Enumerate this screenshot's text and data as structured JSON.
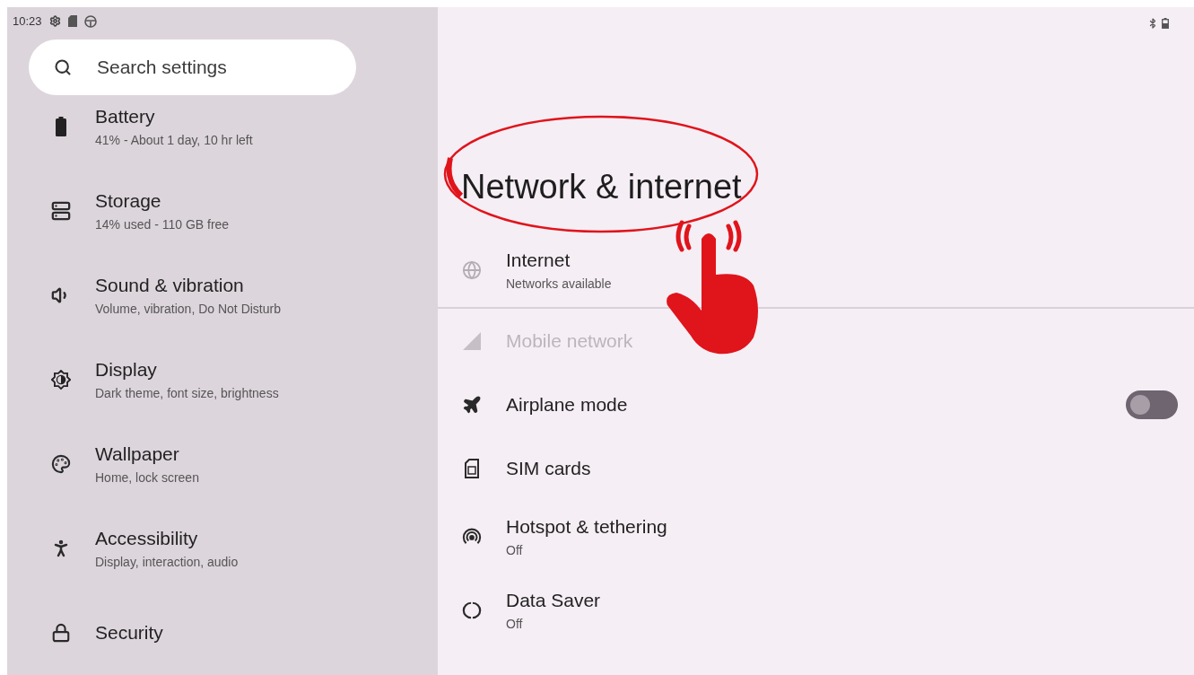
{
  "status_bar": {
    "time": "10:23"
  },
  "sidebar": {
    "search": {
      "placeholder": "Search settings"
    },
    "items": [
      {
        "title": "Battery",
        "subtitle": "41% - About 1 day, 10 hr left"
      },
      {
        "title": "Storage",
        "subtitle": "14% used - 110 GB free"
      },
      {
        "title": "Sound & vibration",
        "subtitle": "Volume, vibration, Do Not Disturb"
      },
      {
        "title": "Display",
        "subtitle": "Dark theme, font size, brightness"
      },
      {
        "title": "Wallpaper",
        "subtitle": "Home, lock screen"
      },
      {
        "title": "Accessibility",
        "subtitle": "Display, interaction, audio"
      },
      {
        "title": "Security"
      }
    ]
  },
  "content": {
    "title": "Network & internet",
    "rows": [
      {
        "kind": "link",
        "title": "Internet",
        "subtitle": "Networks available",
        "disabled": false
      },
      {
        "kind": "link",
        "title": "Mobile network",
        "disabled": true
      },
      {
        "kind": "toggle",
        "title": "Airplane mode",
        "disabled": false,
        "on": false
      },
      {
        "kind": "link",
        "title": "SIM cards",
        "disabled": false
      },
      {
        "kind": "link",
        "title": "Hotspot & tethering",
        "subtitle": "Off",
        "disabled": false
      },
      {
        "kind": "link",
        "title": "Data Saver",
        "subtitle": "Off",
        "disabled": false
      }
    ]
  }
}
